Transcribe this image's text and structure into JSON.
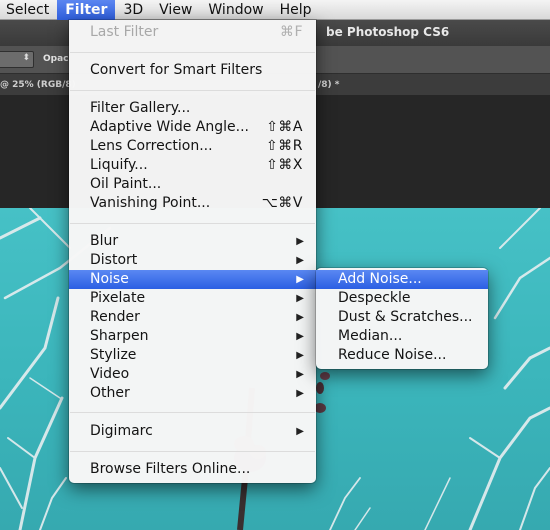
{
  "menubar": {
    "items": [
      "Select",
      "Filter",
      "3D",
      "View",
      "Window",
      "Help"
    ],
    "active": "Filter"
  },
  "app": {
    "title_partial": "be Photoshop CS6",
    "opacity_partial": "Opac",
    "tab_left_partial": "@ 25% (RGB/8)",
    "tab_right_partial": "/8) *"
  },
  "filter_menu": {
    "last_filter": {
      "label": "Last Filter",
      "shortcut": "⌘F"
    },
    "convert": "Convert for Smart Filters",
    "group1": [
      {
        "label": "Filter Gallery...",
        "shortcut": ""
      },
      {
        "label": "Adaptive Wide Angle...",
        "shortcut": "⇧⌘A"
      },
      {
        "label": "Lens Correction...",
        "shortcut": "⇧⌘R"
      },
      {
        "label": "Liquify...",
        "shortcut": "⇧⌘X"
      },
      {
        "label": "Oil Paint...",
        "shortcut": ""
      },
      {
        "label": "Vanishing Point...",
        "shortcut": "⌥⌘V"
      }
    ],
    "submenus": [
      "Blur",
      "Distort",
      "Noise",
      "Pixelate",
      "Render",
      "Sharpen",
      "Stylize",
      "Video",
      "Other"
    ],
    "highlighted": "Noise",
    "digimarc": "Digimarc",
    "browse": "Browse Filters Online...",
    "arrow_glyph": "▶"
  },
  "noise_submenu": {
    "items": [
      "Add Noise...",
      "Despeckle",
      "Dust & Scratches...",
      "Median...",
      "Reduce Noise..."
    ],
    "highlighted": "Add Noise..."
  },
  "colors": {
    "highlight": "#2f5fde",
    "canvas": "#3bb5bb"
  }
}
